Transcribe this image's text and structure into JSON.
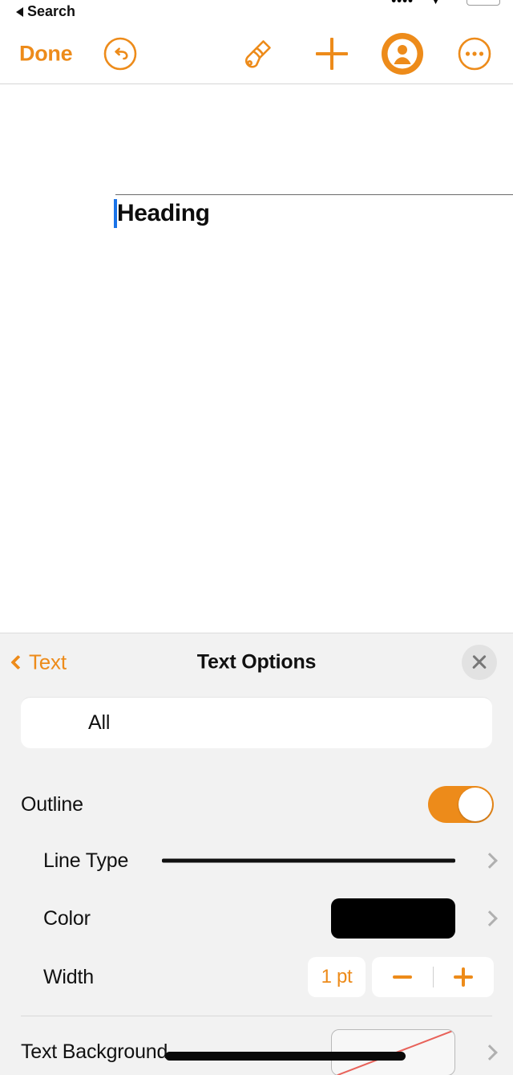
{
  "statusbar": {
    "signal_icon": "signal-dots-icon",
    "wifi_icon": "wifi-icon",
    "battery_icon": "battery-icon"
  },
  "back_link": {
    "label": "Search",
    "icon": "back-triangle-icon"
  },
  "toolbar": {
    "done_label": "Done",
    "undo_icon": "undo-circle-icon",
    "format_icon": "paintbrush-icon",
    "insert_icon": "plus-icon",
    "collaborate_icon": "person-circle-icon",
    "more_icon": "ellipsis-circle-icon",
    "accent_color": "#ED8B1A"
  },
  "document": {
    "heading_text": "Heading",
    "caret_color": "#1a73e8",
    "rule_color": "#6b6b6b"
  },
  "panel": {
    "back_label": "Text",
    "back_icon": "chevron-left-icon",
    "title": "Text Options",
    "close_icon": "close-x-icon",
    "segment": {
      "label": "All"
    },
    "rows": {
      "outline": {
        "label": "Outline",
        "toggle_on": true,
        "toggle_color": "#ED8B1A"
      },
      "line_type": {
        "label": "Line Type",
        "preview": "solid-line",
        "preview_color": "#111111",
        "disclosure_icon": "chevron-right-icon"
      },
      "color": {
        "label": "Color",
        "swatch_color": "#000000",
        "disclosure_icon": "chevron-right-icon"
      },
      "width": {
        "label": "Width",
        "value": "1 pt",
        "decrement_icon": "minus-icon",
        "increment_icon": "plus-icon"
      },
      "text_background": {
        "label": "Text Background",
        "swatch": "no-color",
        "slash_color": "#e8625a",
        "disclosure_icon": "chevron-right-icon"
      }
    }
  },
  "annotation": {
    "ink_stroke": "black-ink-stroke"
  }
}
